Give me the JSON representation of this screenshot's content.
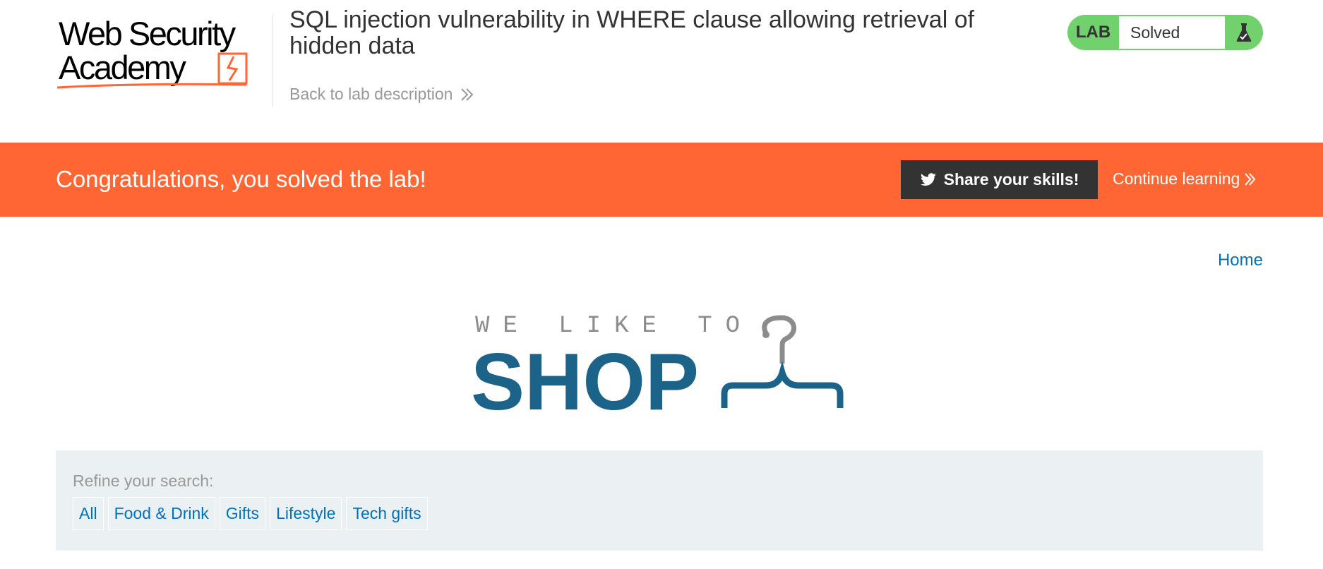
{
  "header": {
    "logo_text": "Web Security Academy",
    "lab_title": "SQL injection vulnerability in WHERE clause allowing retrieval of hidden data",
    "back_link": "Back to lab description",
    "lab_status": {
      "label": "LAB",
      "value": "Solved",
      "icon": "flask-icon",
      "color": "#70d16d"
    }
  },
  "banner": {
    "message": "Congratulations, you solved the lab!",
    "share_button": "Share your skills!",
    "share_icon": "twitter-icon",
    "continue_link": "Continue learning",
    "color": "#ff6633"
  },
  "nav": {
    "home_link": "Home"
  },
  "shop_logo": {
    "tagline": "WE LIKE TO",
    "name": "SHOP",
    "icon": "hanger-icon",
    "color": "#1b6389"
  },
  "filters": {
    "heading": "Refine your search:",
    "items": [
      "All",
      "Food & Drink",
      "Gifts",
      "Lifestyle",
      "Tech gifts"
    ]
  }
}
